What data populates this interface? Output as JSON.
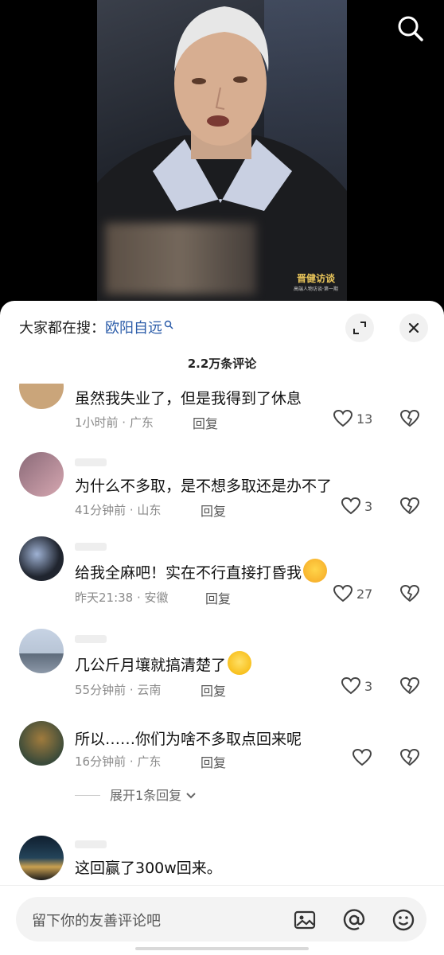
{
  "video": {
    "logo_text": "晋健访谈",
    "logo_sub": "高端人物访谈·第一期"
  },
  "sheet": {
    "search_prefix": "大家都在搜：",
    "search_keyword": "欧阳自远",
    "comment_count": "2.2万条评论",
    "comments": [
      {
        "text": "虽然我失业了，但是我得到了休息",
        "meta": "1小时前 · 广东",
        "reply": "回复",
        "likes": "13"
      },
      {
        "text": "为什么不多取，是不想多取还是办不了",
        "meta": "41分钟前 · 山东",
        "reply": "回复",
        "likes": "3"
      },
      {
        "text": "给我全麻吧！实在不行直接打昏我",
        "meta": "昨天21:38 · 安徽",
        "reply": "回复",
        "likes": "27",
        "emoji": "screaming-face"
      },
      {
        "text": "几公斤月壤就搞清楚了",
        "meta": "55分钟前 · 云南",
        "reply": "回复",
        "likes": "3",
        "emoji": "thinking-face"
      },
      {
        "text": "所以……你们为啥不多取点回来呢",
        "meta": "16分钟前 · 广东",
        "reply": "回复",
        "likes": ""
      },
      {
        "text": "这回赢了300w回来。",
        "meta": "",
        "reply": "",
        "likes": ""
      }
    ],
    "expand_replies": "展开1条回复"
  },
  "input": {
    "placeholder": "留下你的友善评论吧"
  }
}
